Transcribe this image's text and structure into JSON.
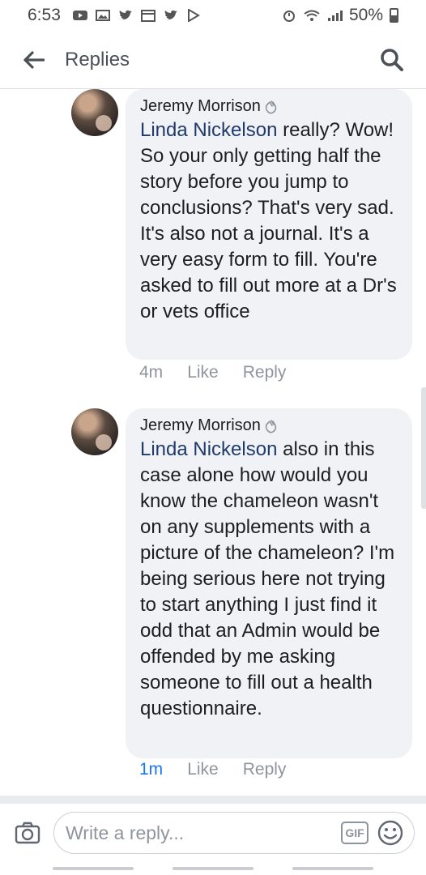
{
  "status_bar": {
    "time": "6:53",
    "battery": "50%"
  },
  "header": {
    "title": "Replies"
  },
  "comments": [
    {
      "author": "Jeremy Morrison",
      "mention": "Linda Nickelson",
      "text": " really? Wow! So your only getting half the story before you jump to conclusions? That's very sad. It's also not a journal. It's a very easy form to fill. You're asked to fill out more at a Dr's or vets office",
      "time": "4m",
      "like": "Like",
      "reply": "Reply"
    },
    {
      "author": "Jeremy Morrison",
      "mention": "Linda Nickelson",
      "text": " also in this case alone how would you know the chameleon wasn't on any supplements with a picture of the chameleon? I'm being serious here not trying to start anything I just find it odd that an Admin would be offended by me asking someone to fill out a health questionnaire.",
      "time": "1m",
      "like": "Like",
      "reply": "Reply"
    }
  ],
  "composer": {
    "placeholder": "Write a reply...",
    "gif_label": "GIF"
  },
  "colors": {
    "link_blue": "#1877f2",
    "bubble_bg": "#f0f2f5",
    "mention": "#1f3a6b"
  },
  "icons": [
    "back-arrow-icon",
    "search-icon",
    "camera-icon",
    "gif-icon",
    "emoji-icon",
    "wave-icon"
  ]
}
